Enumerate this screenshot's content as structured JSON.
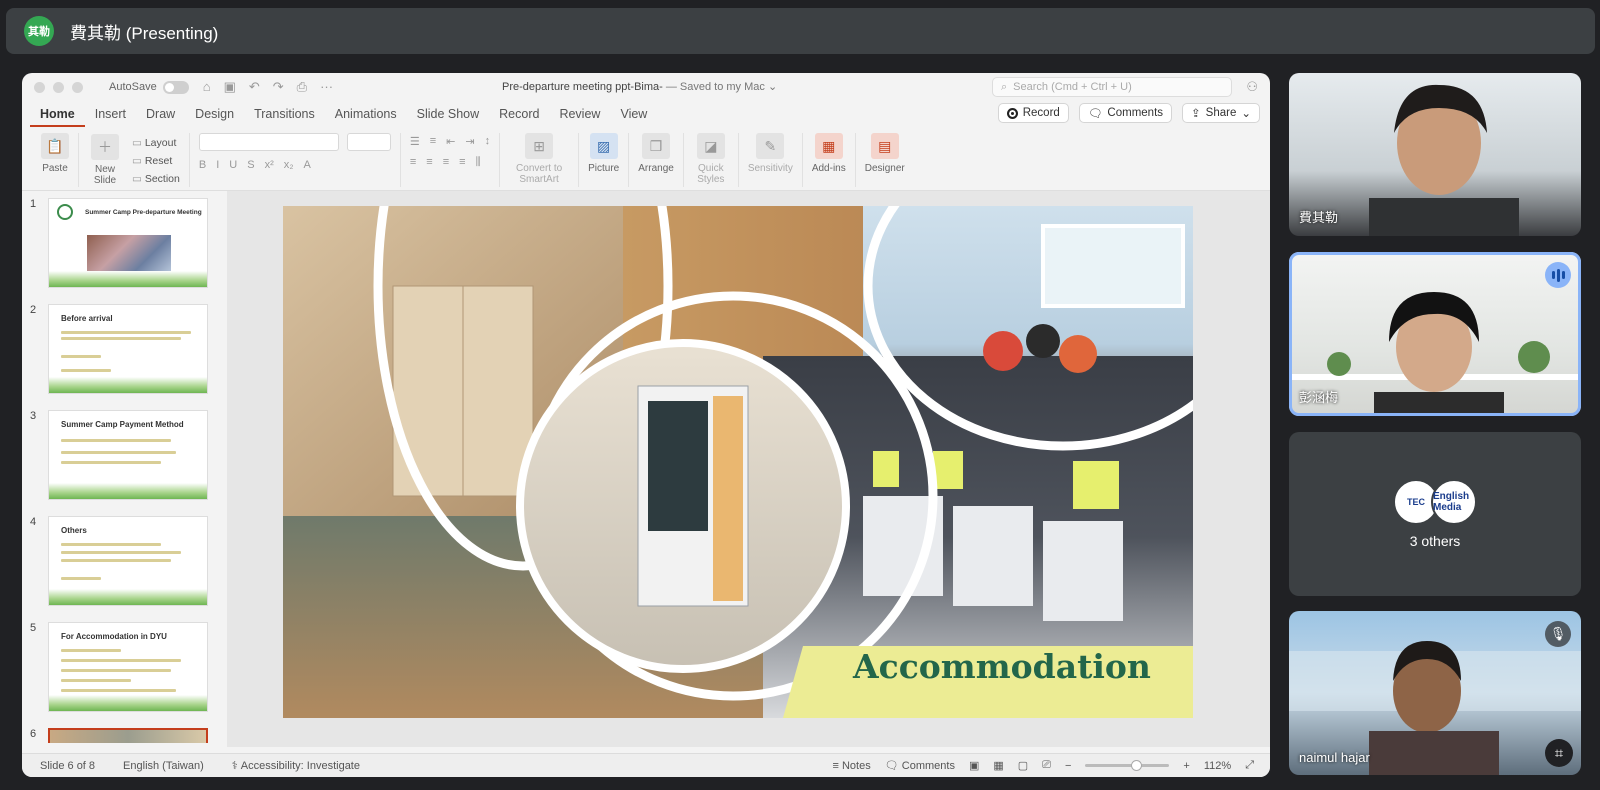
{
  "meeting": {
    "presenter_initials": "其勒",
    "presenter_label": "費其勒 (Presenting)"
  },
  "ppt": {
    "autosave_label": "AutoSave",
    "doc_name": "Pre-departure meeting ppt-Bima-",
    "doc_saved": " — Saved to my Mac ⌄",
    "search_placeholder": "Search (Cmd + Ctrl + U)",
    "tabs": [
      "Home",
      "Insert",
      "Draw",
      "Design",
      "Transitions",
      "Animations",
      "Slide Show",
      "Record",
      "Review",
      "View"
    ],
    "record_label": "Record",
    "comments_label": "Comments",
    "share_label": "Share",
    "ribbon": {
      "paste": "Paste",
      "new_slide": "New Slide",
      "layout": "Layout",
      "reset": "Reset",
      "section": "Section",
      "convert": "Convert to SmartArt",
      "picture": "Picture",
      "arrange": "Arrange",
      "quick_styles": "Quick Styles",
      "sensitivity": "Sensitivity",
      "addins": "Add-ins",
      "designer": "Designer"
    },
    "thumbnails": [
      {
        "num": "1",
        "title": "Summer Camp Pre-departure Meeting"
      },
      {
        "num": "2",
        "title": "Before arrival"
      },
      {
        "num": "3",
        "title": "Summer Camp Payment Method"
      },
      {
        "num": "4",
        "title": "Others"
      },
      {
        "num": "5",
        "title": "For Accommodation in DYU"
      },
      {
        "num": "6",
        "title": ""
      }
    ],
    "slide_banner": "Accommodation",
    "status": {
      "slide_of": "Slide 6 of 8",
      "language": "English (Taiwan)",
      "accessibility": "Accessibility: Investigate",
      "notes": "Notes",
      "comments": "Comments",
      "zoom": "112%"
    }
  },
  "participants": [
    {
      "name": "費其勒"
    },
    {
      "name": "彭涵梅"
    },
    {
      "name": "3 others",
      "avatar_labels": [
        "TEC",
        "English Media"
      ]
    },
    {
      "name": "naimul hajar"
    }
  ]
}
